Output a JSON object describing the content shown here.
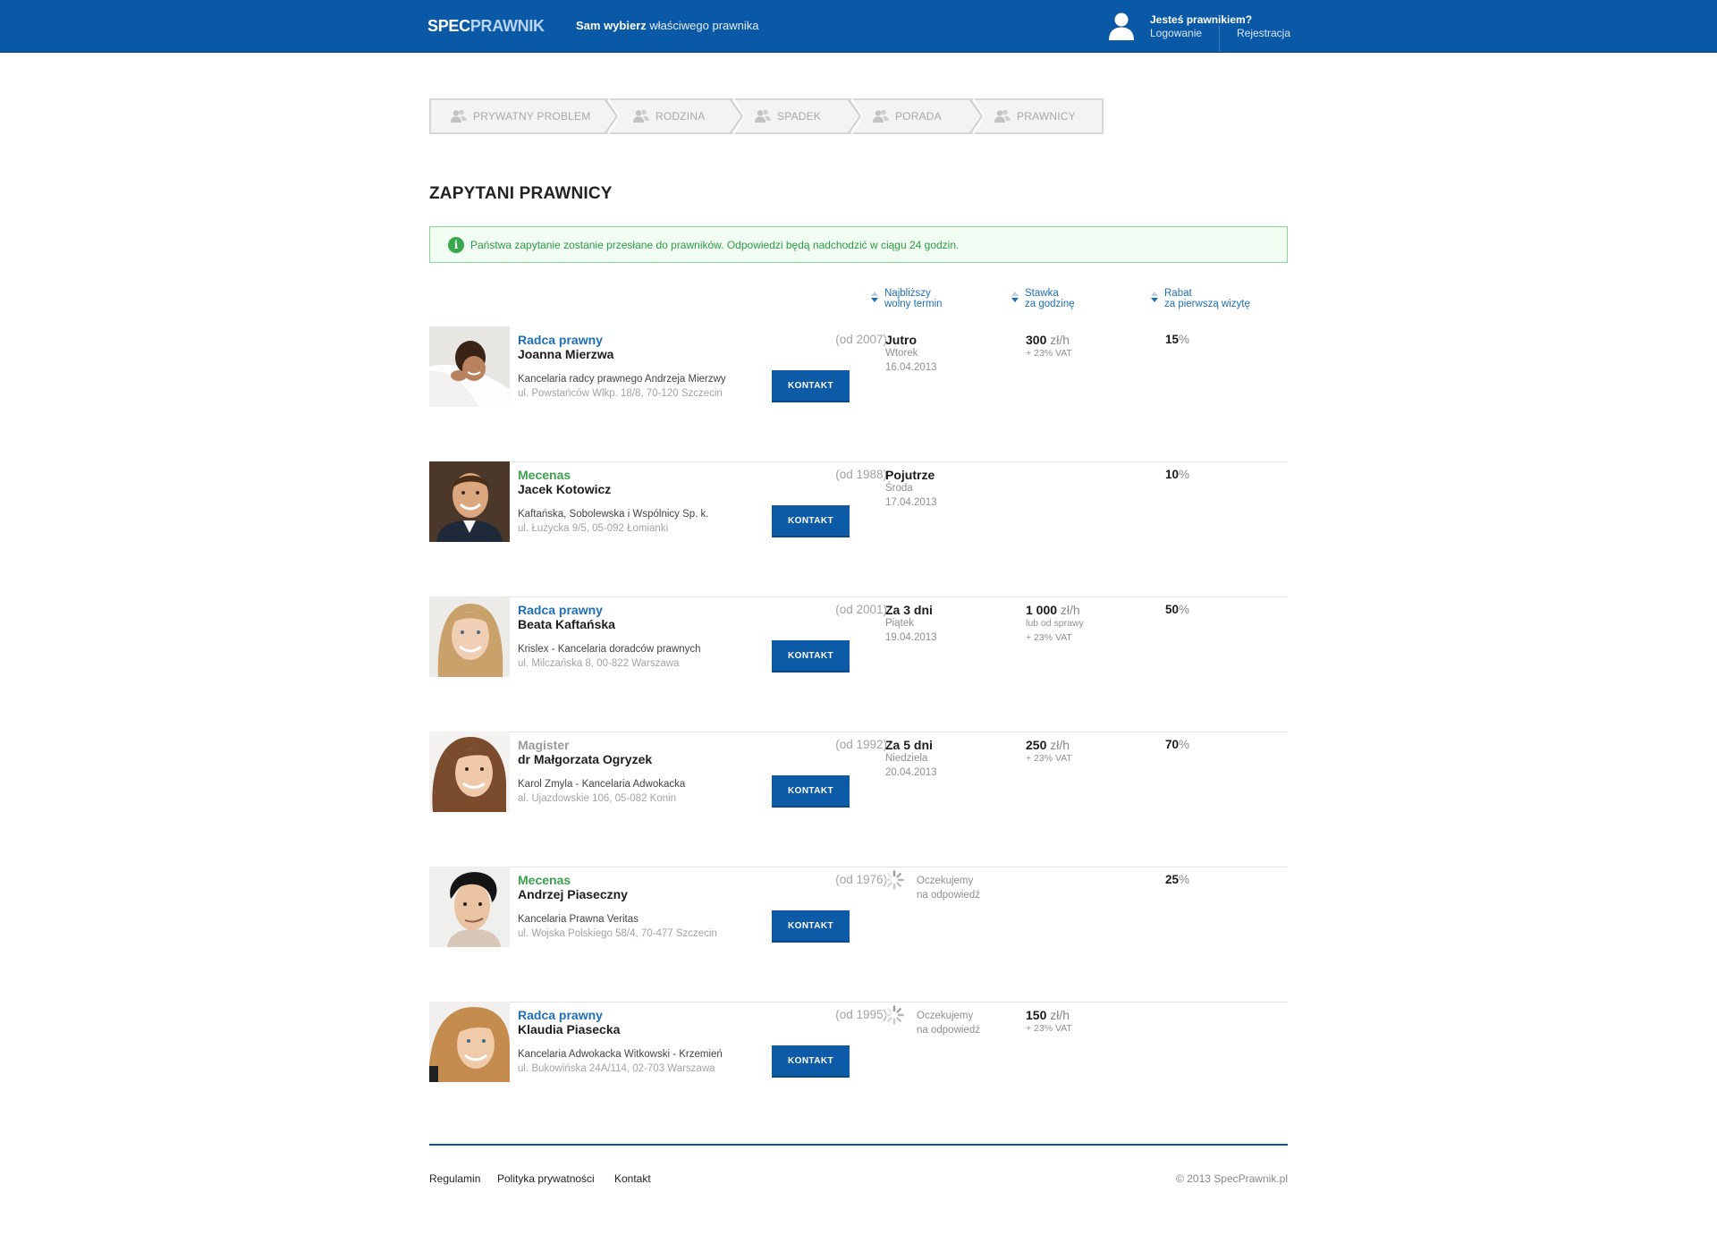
{
  "header": {
    "logo_part1": "SPEC",
    "logo_part2": "PRAWNIK",
    "tagline_bold": "Sam wybierz",
    "tagline_rest": " właściwego prawnika",
    "user_question": "Jesteś prawnikiem?",
    "login": "Logowanie",
    "register": "Rejestracja"
  },
  "breadcrumbs": [
    {
      "label": "PRYWATNY PROBLEM"
    },
    {
      "label": "RODZINA"
    },
    {
      "label": "SPADEK"
    },
    {
      "label": "PORADA"
    },
    {
      "label": "PRAWNICY"
    }
  ],
  "page_title": "ZAPYTANI PRAWNICY",
  "notice": {
    "icon": "i",
    "text": "Państwa zapytanie zostanie przesłane do prawników. Odpowiedzi będą nadchodzić w ciągu 24 godzin."
  },
  "columns": {
    "term": {
      "line1": "Najbliższy",
      "line2": "wolny termin"
    },
    "rate": {
      "line1": "Stawka",
      "line2": "za godzinę"
    },
    "discount": {
      "line1": "Rabat",
      "line2": "za pierwszą wizytę"
    }
  },
  "button_label": "KONTAKT",
  "lawyers": [
    {
      "role": "Radca prawny",
      "role_color": "#1f6fb8",
      "name": "Joanna Mierzwa",
      "since": "(od 2007)",
      "office": "Kancelaria radcy prawnego Andrzeja Mierzwy",
      "address": "ul. Powstańców Wlkp. 18/8, 70-120 Szczecin",
      "term": "Jutro",
      "day": "Wtorek",
      "date": "16.04.2013",
      "rate_value": "300",
      "rate_unit": " zł/h",
      "rate_note1": "+ 23% VAT",
      "rate_note2": "",
      "discount_value": "15",
      "discount_unit": "%"
    },
    {
      "role": "Mecenas",
      "role_color": "#3aa14d",
      "name": "Jacek Kotowicz",
      "since": "(od 1988)",
      "office": "Kaftańska, Sobolewska i Wspólnicy Sp. k.",
      "address": "ul. Łużycka 9/5, 05-092 Łomianki",
      "term": "Pojutrze",
      "day": "Środa",
      "date": "17.04.2013",
      "rate_value": "",
      "rate_unit": "",
      "rate_note1": "",
      "rate_note2": "",
      "discount_value": "10",
      "discount_unit": "%"
    },
    {
      "role": "Radca prawny",
      "role_color": "#1f6fb8",
      "name": "Beata Kaftańska",
      "since": "(od 2001)",
      "office": "Krislex - Kancelaria doradców prawnych",
      "address": "ul. Milczańska 8, 00-822 Warszawa",
      "term": "Za 3 dni",
      "day": "Piątek",
      "date": "19.04.2013",
      "rate_value": "1 000",
      "rate_unit": " zł/h",
      "rate_note1": "lub od sprawy",
      "rate_note2": "+ 23% VAT",
      "discount_value": "50",
      "discount_unit": "%"
    },
    {
      "role": "Magister",
      "role_color": "#9a9a9a",
      "name": "dr Małgorzata Ogryzek",
      "since": "(od 1992)",
      "office": "Karol Zmyla - Kancelaria Adwokacka",
      "address": "al. Ujazdowskie 106, 05-082 Konin",
      "term": "Za 5 dni",
      "day": "Niedziela",
      "date": "20.04.2013",
      "rate_value": "250",
      "rate_unit": " zł/h",
      "rate_note1": "+ 23% VAT",
      "rate_note2": "",
      "discount_value": "70",
      "discount_unit": "%"
    },
    {
      "role": "Mecenas",
      "role_color": "#3aa14d",
      "name": "Andrzej Piaseczny",
      "since": "(od 1976)",
      "office": "Kancelaria Prawna Veritas",
      "address": "ul. Wojska Polskiego 58/4, 70-477 Szczecin",
      "waiting1": "Oczekujemy",
      "waiting2": "na odpowiedź",
      "rate_value": "",
      "rate_unit": "",
      "rate_note1": "",
      "rate_note2": "",
      "discount_value": "25",
      "discount_unit": "%"
    },
    {
      "role": "Radca prawny",
      "role_color": "#1f6fb8",
      "name": "Klaudia Piasecka",
      "since": "(od 1995)",
      "office": "Kancelaria Adwokacka Witkowski - Krzemień",
      "address": "ul. Bukowińska 24A/114, 02-703 Warszawa",
      "waiting1": "Oczekujemy",
      "waiting2": "na odpowiedź",
      "rate_value": "150",
      "rate_unit": " zł/h",
      "rate_note1": "+ 23% VAT",
      "rate_note2": "",
      "discount_value": "",
      "discount_unit": ""
    }
  ],
  "footer": {
    "links": [
      "Regulamin",
      "Polityka prywatności",
      "Kontakt"
    ],
    "copyright": "© 2013 SpecPrawnik.pl"
  }
}
